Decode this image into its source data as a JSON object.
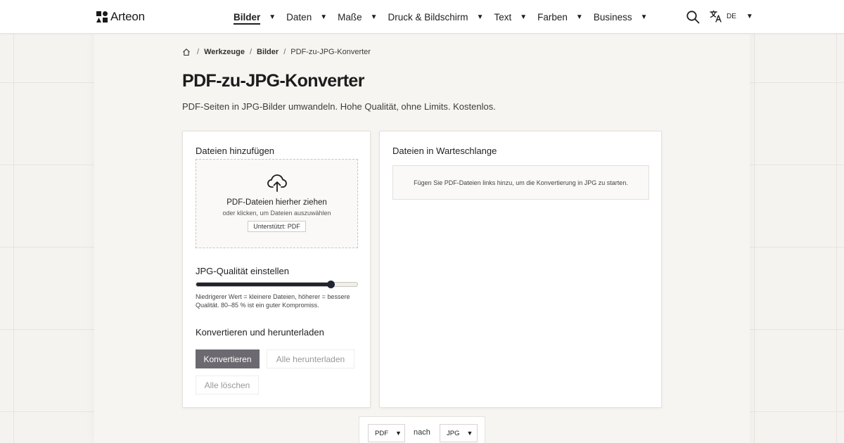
{
  "header": {
    "logo_text": "Arteon",
    "nav": [
      {
        "label": "Bilder",
        "active": true
      },
      {
        "label": "Daten",
        "active": false
      },
      {
        "label": "Maße",
        "active": false
      },
      {
        "label": "Druck & Bildschirm",
        "active": false
      },
      {
        "label": "Text",
        "active": false
      },
      {
        "label": "Farben",
        "active": false
      },
      {
        "label": "Business",
        "active": false
      }
    ],
    "search_icon": "search-icon",
    "language": "DE",
    "language_icon": "translate-icon"
  },
  "breadcrumb": {
    "home_icon": "home-icon",
    "items": [
      "Werkzeuge",
      "Bilder",
      "PDF-zu-JPG-Konverter"
    ]
  },
  "page": {
    "title": "PDF-zu-JPG-Konverter",
    "subtitle": "PDF-Seiten in JPG-Bilder umwandeln. Hohe Qualität, ohne Limits. Kostenlos."
  },
  "add_files": {
    "title": "Dateien hinzufügen",
    "upload_icon": "cloud-upload-icon",
    "drop_title": "PDF-Dateien hierher ziehen",
    "drop_subtitle": "oder klicken, um Dateien auszuwählen",
    "supported_badge": "Unterstützt: PDF"
  },
  "quality": {
    "title": "JPG-Qualität einstellen",
    "value_fraction": 0.84,
    "hint": "Niedrigerer Wert = kleinere Dateien, höherer = bessere Qualität. 80–85 % ist ein guter Kompromiss."
  },
  "actions": {
    "title": "Konvertieren und herunterladen",
    "convert_label": "Konvertieren",
    "download_all_label": "Alle herunterladen",
    "clear_all_label": "Alle löschen"
  },
  "queue": {
    "title": "Dateien in Warteschlange",
    "empty_message": "Fügen Sie PDF-Dateien links hinzu, um die Konvertierung in JPG zu starten."
  },
  "converter_selector": {
    "from": "PDF",
    "between": "nach",
    "to": "JPG"
  },
  "colors": {
    "accent_dark": "#1f2433",
    "primary_button": "#6c6a70",
    "page_background": "#f5f3f0"
  }
}
